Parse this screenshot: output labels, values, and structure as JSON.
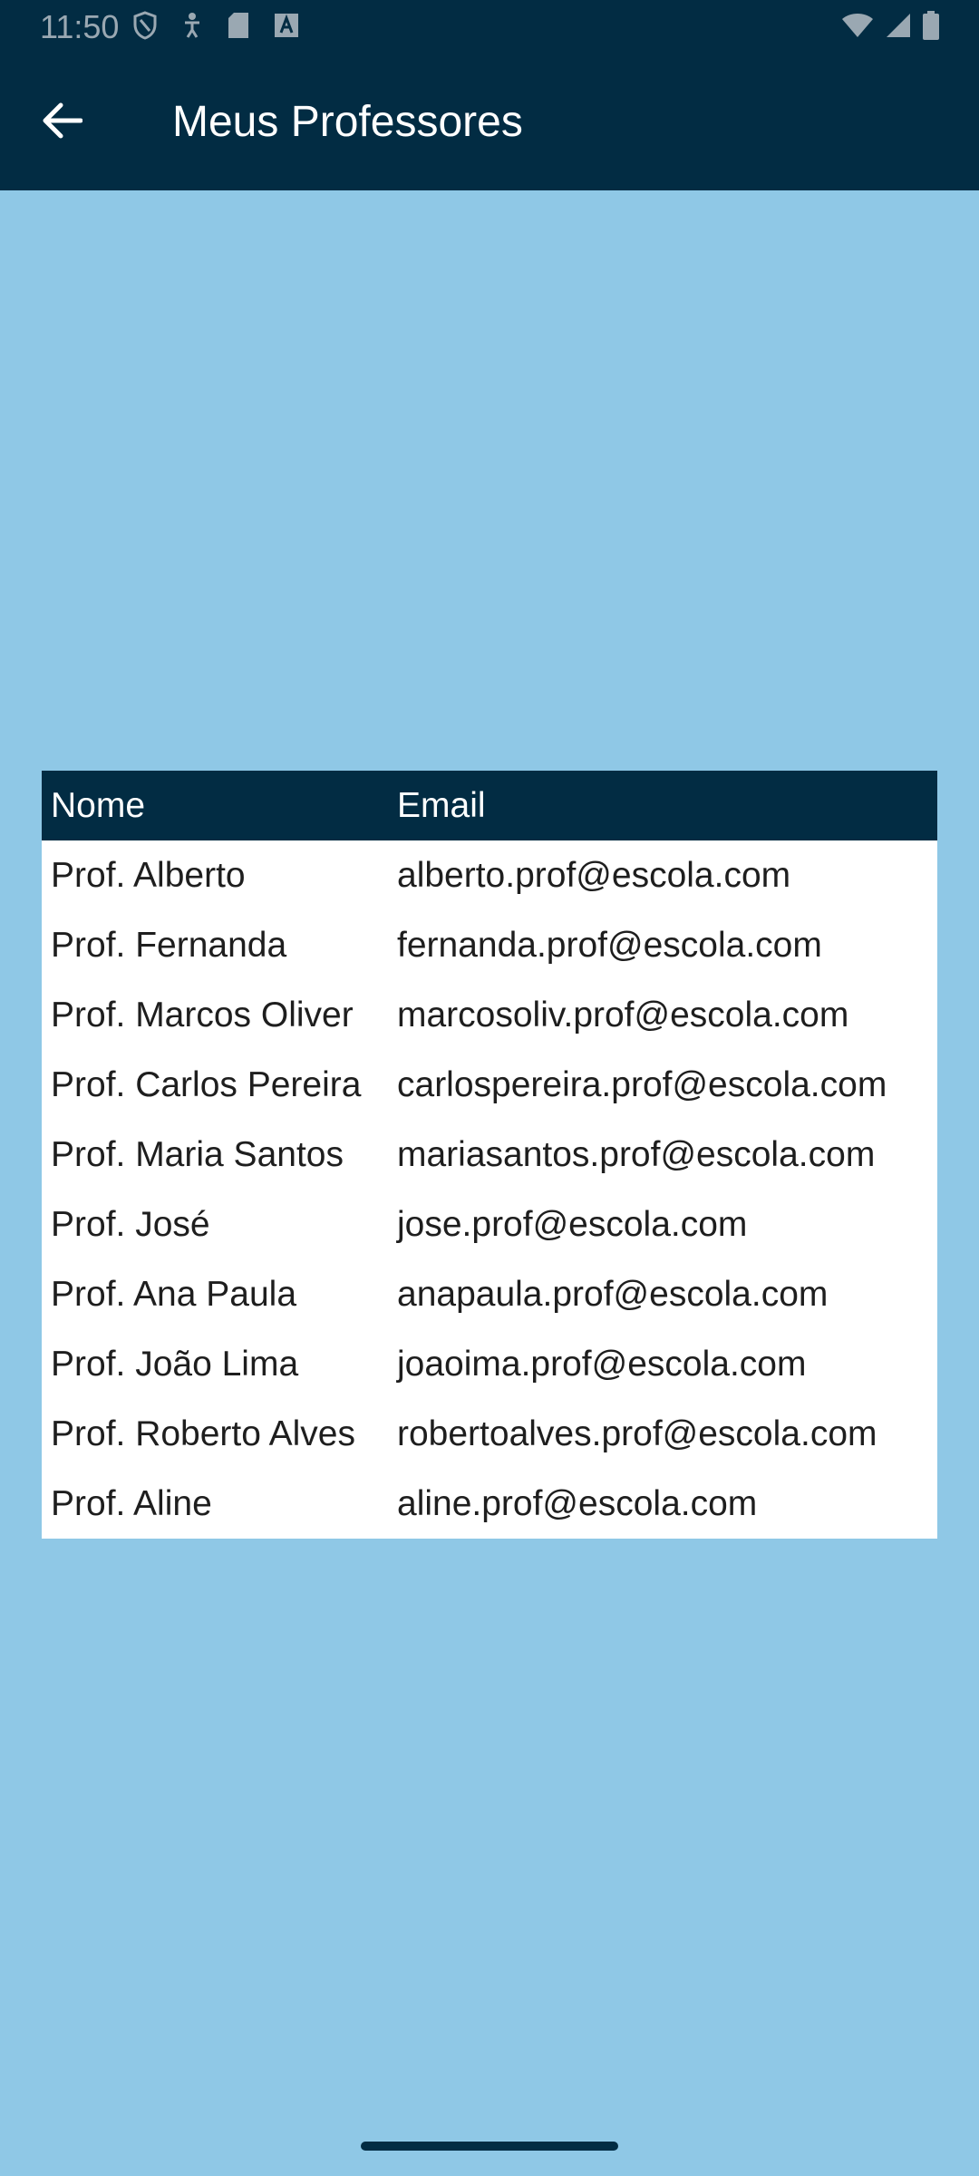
{
  "status_bar": {
    "time": "11:50",
    "left_icons": [
      "shield-icon",
      "accessibility-icon",
      "sd-card-icon",
      "font-a-icon"
    ],
    "right_icons": [
      "wifi-icon",
      "signal-icon",
      "battery-icon"
    ]
  },
  "app_bar": {
    "title": "Meus Professores",
    "back_icon": "arrow-back-icon"
  },
  "colors": {
    "primary": "#022c43",
    "background": "#8fc8e6",
    "table_background": "#ffffff",
    "header_text": "#ffffff"
  },
  "table": {
    "headers": [
      "Nome",
      "Email"
    ],
    "rows": [
      {
        "name": "Prof. Alberto",
        "email": "alberto.prof@escola.com"
      },
      {
        "name": "Prof. Fernanda",
        "email": "fernanda.prof@escola.com"
      },
      {
        "name": "Prof. Marcos Oliver",
        "email": "marcosoliv.prof@escola.com"
      },
      {
        "name": "Prof. Carlos Pereira",
        "email": "carlospereira.prof@escola.com"
      },
      {
        "name": "Prof. Maria Santos",
        "email": "mariasantos.prof@escola.com"
      },
      {
        "name": "Prof. José",
        "email": "jose.prof@escola.com"
      },
      {
        "name": "Prof. Ana Paula",
        "email": "anapaula.prof@escola.com"
      },
      {
        "name": "Prof. João Lima",
        "email": "joaoima.prof@escola.com"
      },
      {
        "name": "Prof. Roberto Alves",
        "email": "robertoalves.prof@escola.com"
      },
      {
        "name": "Prof. Aline",
        "email": "aline.prof@escola.com"
      }
    ]
  }
}
